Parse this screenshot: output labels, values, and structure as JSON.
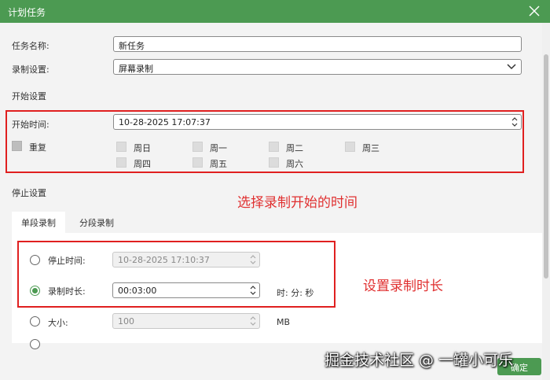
{
  "window": {
    "title": "计划任务",
    "close_icon": "close-icon"
  },
  "task_name": {
    "label": "任务名称:",
    "value": "新任务"
  },
  "record_setting": {
    "label": "录制设置:",
    "value": "屏幕录制"
  },
  "start_section": {
    "heading": "开始设置",
    "start_time": {
      "label": "开始时间:",
      "value": "10-28-2025 17:07:37"
    },
    "repeat_label": "重复",
    "days": [
      "周日",
      "周一",
      "周二",
      "周三",
      "周四",
      "周五",
      "周六"
    ]
  },
  "annotations": {
    "start": "选择录制开始的时间",
    "duration": "设置录制时长"
  },
  "stop_section": {
    "heading": "停止设置",
    "tabs": [
      "单段录制",
      "分段录制"
    ],
    "active_tab": 0,
    "stop_time": {
      "label": "停止时间:",
      "value": "10-28-2025 17:10:37"
    },
    "duration": {
      "label": "录制时长:",
      "value": "00:03:00",
      "unit": "时: 分: 秒"
    },
    "size": {
      "label": "大小:",
      "value": "100",
      "unit": "MB"
    },
    "selected_option": "duration"
  },
  "ok_button": "确定",
  "watermark": "掘金技术社区 @ 一罐小可乐",
  "colors": {
    "title_bar": "#4c9a52",
    "accent": "#4c9a52",
    "annotation": "#e03030"
  }
}
